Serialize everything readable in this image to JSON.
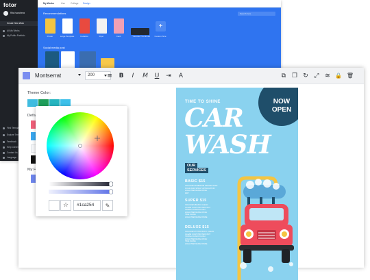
{
  "dashboard": {
    "logo": "fotor",
    "user_name": "Rita Ivancheva",
    "create_label": "Create New Work",
    "sidebar_items": [
      {
        "label": "All My Works"
      },
      {
        "label": "My Public Portfolio"
      }
    ],
    "sidebar_bottom_items": [
      {
        "label": "Find Templates"
      },
      {
        "label": "Explore Templates"
      },
      {
        "label": "Feedback"
      },
      {
        "label": "Help Center"
      },
      {
        "label": "Contact Us"
      },
      {
        "label": "Language"
      }
    ],
    "tabs": [
      {
        "label": "My Works"
      },
      {
        "label": "Use"
      },
      {
        "label": "Collage"
      },
      {
        "label": "Design"
      }
    ],
    "search_placeholder": "Search here",
    "recommendations_label": "Recommendations",
    "social_media_label": "Social media post",
    "cards": [
      {
        "label": "Poster",
        "color": "#f4c542"
      },
      {
        "label": "Large Template",
        "color": "#ffffff"
      },
      {
        "label": "Invitation",
        "color": "#e94a3f"
      },
      {
        "label": "Flyer",
        "color": "#f2f2f2"
      },
      {
        "label": "Card",
        "color": "#f0a0b4"
      },
      {
        "label": "Youtube Thumbnail",
        "color": "#222831"
      }
    ],
    "add_label": "+",
    "custom_size_label": "Custom Size",
    "social_cards": [
      {
        "color": "#1c5a80"
      },
      {
        "color": "#ffffff"
      },
      {
        "color": "#3a6db0"
      },
      {
        "color": "#f7c84a"
      }
    ]
  },
  "toolbar": {
    "swatch_color": "#7a8df0",
    "font_name": "Montserrat",
    "font_size": "200",
    "icons": [
      {
        "name": "align-icon",
        "glyph": "≡"
      },
      {
        "name": "bold-icon",
        "glyph": "B"
      },
      {
        "name": "italic-icon",
        "glyph": "I"
      },
      {
        "name": "text-style-icon",
        "glyph": "M"
      },
      {
        "name": "underline-icon",
        "glyph": "U"
      },
      {
        "name": "letter-spacing-icon",
        "glyph": "⇥"
      },
      {
        "name": "font-case-icon",
        "glyph": "A"
      }
    ],
    "right_icons": [
      {
        "name": "copy-icon",
        "glyph": "⧉"
      },
      {
        "name": "duplicate-icon",
        "glyph": "❐"
      },
      {
        "name": "rotate-icon",
        "glyph": "↻"
      },
      {
        "name": "flip-icon",
        "glyph": "⤢"
      },
      {
        "name": "layers-icon",
        "glyph": "≋"
      },
      {
        "name": "lock-icon",
        "glyph": "🔒"
      },
      {
        "name": "delete-icon",
        "glyph": "🗑"
      }
    ]
  },
  "color_panel": {
    "theme_color_label": "Theme Color:",
    "theme_colors": [
      "#3fbce0",
      "#1e9e5a",
      "#26b5c0",
      "#3dc0ea"
    ],
    "default_label": "Default",
    "default_colors": [
      "#f2607a",
      "#3aa8f0",
      "#f8f9fb",
      "#111111"
    ],
    "my_label": "My F",
    "my_colors": [
      "#6f86ee"
    ]
  },
  "picker": {
    "hex_value": "#1ca254",
    "fav_icon": "☆",
    "eyedropper_icon": "✎",
    "slider1_value": 0.97,
    "slider2_value": 0.97
  },
  "poster": {
    "badge_top": "NOW",
    "badge_bottom": "OPEN",
    "tagline": "TIME TO SHINE",
    "title_line1": "CAR",
    "title_line2": "WASH",
    "our_label": "OUR",
    "services_label": "SERVICES",
    "sections": [
      {
        "title": "BASIC $15",
        "lines": [
          "INCLUDES PREMIUM PROTECTANT",
          "FOAM AND SPRAY APPLICATION",
          "HIGH PRESSURE WASH",
          "DRY"
        ]
      },
      {
        "title": "SUPER $15",
        "lines": [
          "INCLUDES BASIC CLEAN",
          "CLEAR COAT PROTECTANT",
          "TRIPLE FOAM POLISH",
          "HIGH PRESSURE WASH",
          "TIRE SHINE",
          "HIGH PRESSURE RINSE"
        ]
      },
      {
        "title": "DELUXE $15",
        "lines": [
          "INCLUDES TOTAL BODY CLEAN",
          "CLEAR COAT PROTECTANT",
          "TRIPLE FOAM POLISH",
          "HIGH PRESSURE WASH",
          "TIRE SHINE",
          "HIGH PRESSURE RINSE"
        ]
      }
    ]
  }
}
